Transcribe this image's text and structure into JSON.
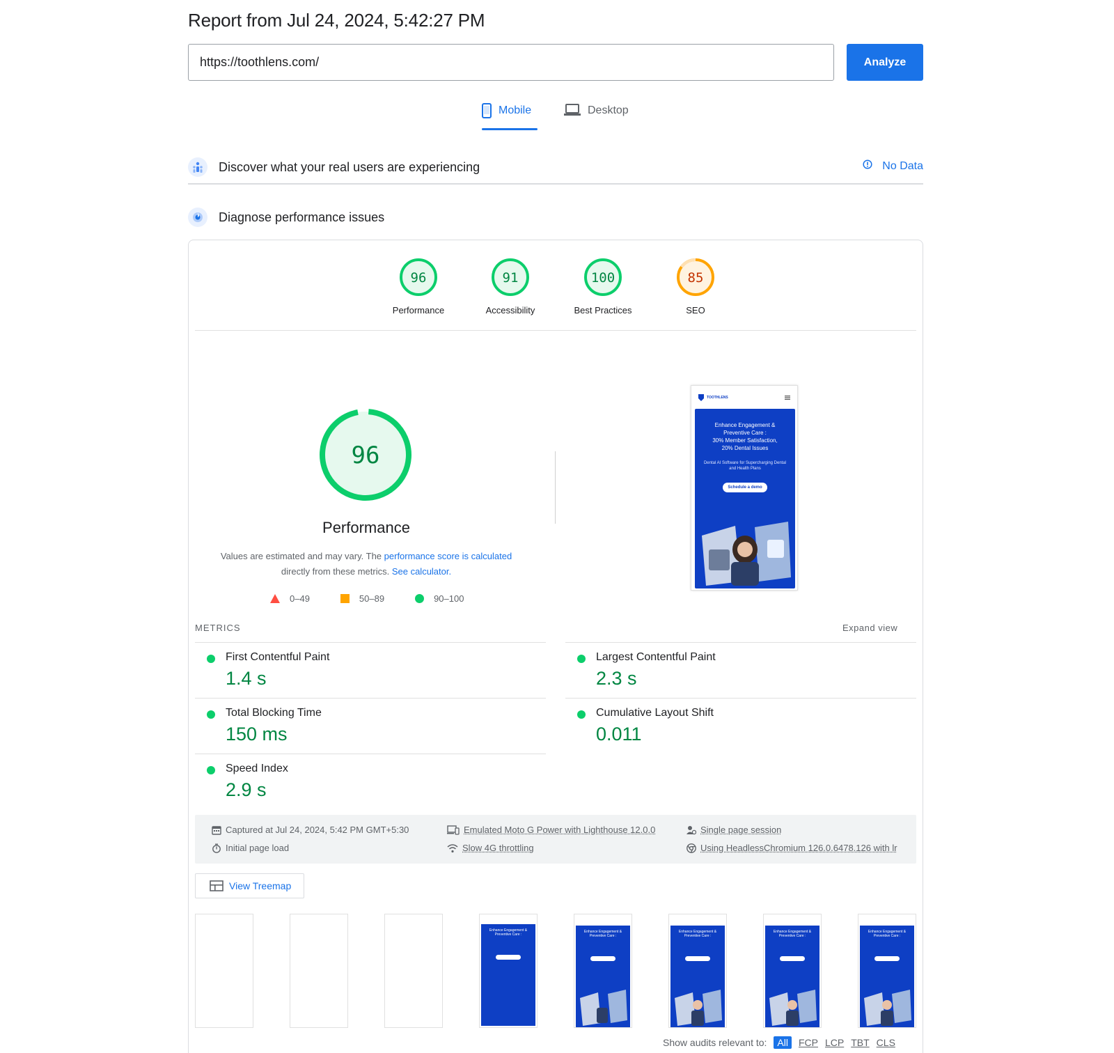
{
  "header": {
    "title": "Report from Jul 24, 2024, 5:42:27 PM",
    "url_value": "https://toothlens.com/",
    "analyze_label": "Analyze"
  },
  "tabs": [
    {
      "label": "Mobile",
      "active": true
    },
    {
      "label": "Desktop",
      "active": false
    }
  ],
  "crux": {
    "label": "Discover what your real users are experiencing",
    "status": "No Data"
  },
  "diagnose": {
    "label": "Diagnose performance issues"
  },
  "category_scores": [
    {
      "name": "Performance",
      "score": 96,
      "color": "#0cce6b"
    },
    {
      "name": "Accessibility",
      "score": 91,
      "color": "#0cce6b"
    },
    {
      "name": "Best Practices",
      "score": 100,
      "color": "#0cce6b"
    },
    {
      "name": "SEO",
      "score": 85,
      "color": "#ffa400"
    }
  ],
  "performance": {
    "score": "96",
    "title": "Performance",
    "desc_prefix": "Values are estimated and may vary. The ",
    "desc_link": "performance score is calculated",
    "desc_middle": "directly from these metrics. ",
    "desc_link2": "See calculator.",
    "legend": [
      "0–49",
      "50–89",
      "90–100"
    ]
  },
  "preview": {
    "brand": "TOOTHLENS",
    "headline_1": "Enhance Engagement &",
    "headline_2": "Preventive Care :",
    "headline_3": "30%   Member Satisfaction,",
    "headline_4": "20%   Dental Issues",
    "subtext": "Dental AI Software for Supercharging Dental and Health Plans",
    "cta": "Schedule a demo"
  },
  "metrics": {
    "title": "METRICS",
    "expand_label": "Expand view",
    "items": [
      {
        "name": "First Contentful Paint",
        "value": "1.4 s"
      },
      {
        "name": "Largest Contentful Paint",
        "value": "2.3 s"
      },
      {
        "name": "Total Blocking Time",
        "value": "150 ms"
      },
      {
        "name": "Cumulative Layout Shift",
        "value": "0.011"
      },
      {
        "name": "Speed Index",
        "value": "2.9 s"
      }
    ]
  },
  "environment": {
    "captured": "Captured at Jul 24, 2024, 5:42 PM GMT+5:30",
    "load": "Initial page load",
    "device": "Emulated Moto G Power with Lighthouse 12.0.0",
    "throttling": "Slow 4G throttling",
    "session": "Single page session",
    "browser": "Using HeadlessChromium 126.0.6478.126 with lr"
  },
  "treemap_label": "View Treemap",
  "filmstrip": {
    "frame_text": "Enhance Engagement & Preventive Care :"
  },
  "audits_filter": {
    "label": "Show audits relevant to:",
    "chips": [
      "All",
      "FCP",
      "LCP",
      "TBT",
      "CLS"
    ]
  }
}
